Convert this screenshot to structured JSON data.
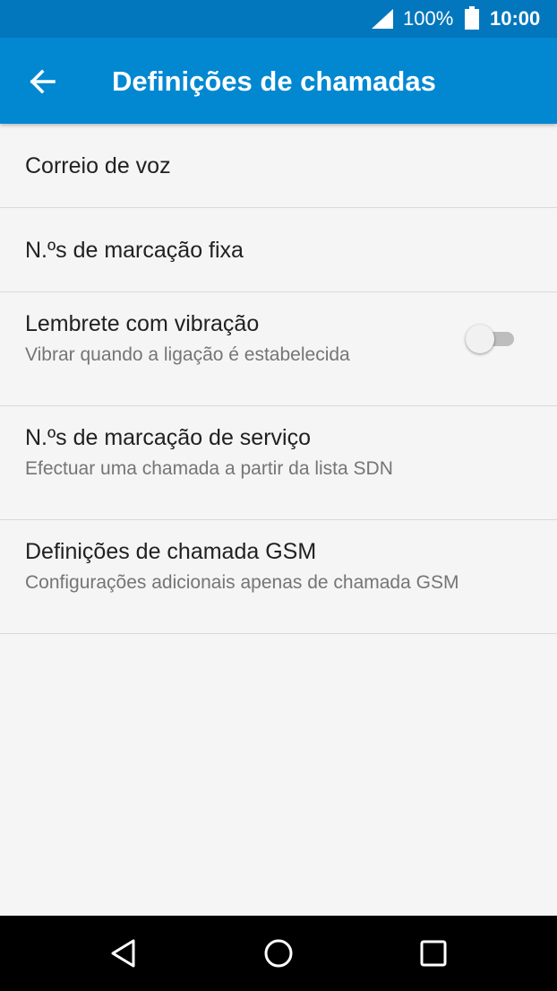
{
  "status_bar": {
    "battery": "100%",
    "time": "10:00",
    "icons": [
      "signal-icon",
      "battery-icon"
    ]
  },
  "app_bar": {
    "title": "Definições de chamadas",
    "back_icon": "arrow-back-icon",
    "color": "#0288d1"
  },
  "items": [
    {
      "title": "Correio de voz"
    },
    {
      "title": "N.ºs de marcação fixa"
    },
    {
      "title": "Lembrete com vibração",
      "subtitle": "Vibrar quando a ligação é estabelecida",
      "toggle_on": false
    },
    {
      "title": "N.ºs de marcação de serviço",
      "subtitle": "Efectuar uma chamada a partir da lista SDN"
    },
    {
      "title": "Definições de chamada GSM",
      "subtitle": "Configurações adicionais apenas de chamada GSM"
    }
  ],
  "nav_bar": {
    "icons": [
      "nav-back-icon",
      "nav-home-icon",
      "nav-recents-icon"
    ]
  }
}
